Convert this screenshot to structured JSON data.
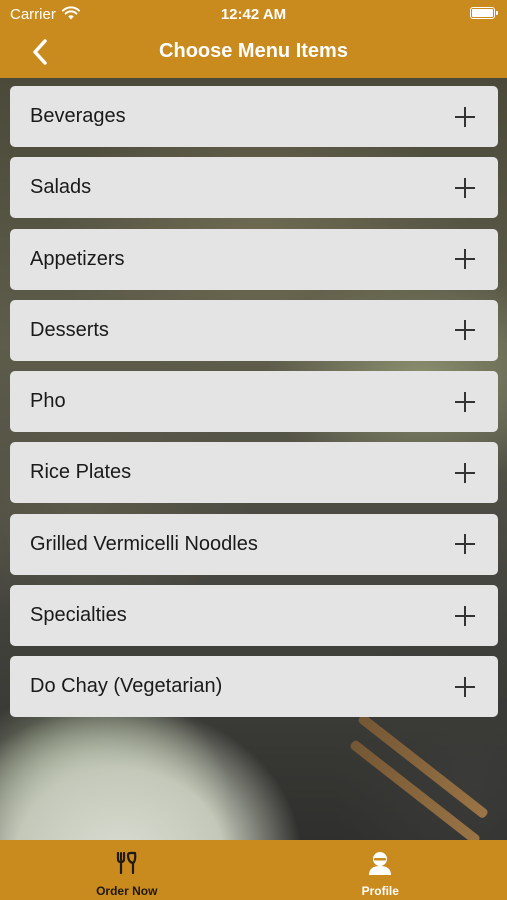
{
  "status_bar": {
    "carrier": "Carrier",
    "time": "12:42 AM"
  },
  "nav": {
    "title": "Choose Menu Items",
    "back_icon": "chevron-left-icon"
  },
  "menu": {
    "items": [
      {
        "label": "Beverages"
      },
      {
        "label": "Salads"
      },
      {
        "label": "Appetizers"
      },
      {
        "label": "Desserts"
      },
      {
        "label": "Pho"
      },
      {
        "label": "Rice Plates"
      },
      {
        "label": "Grilled Vermicelli Noodles"
      },
      {
        "label": "Specialties"
      },
      {
        "label": "Do Chay (Vegetarian)"
      }
    ],
    "expand_icon": "plus-icon"
  },
  "tab_bar": {
    "tabs": [
      {
        "label": "Order Now",
        "icon": "utensils-icon",
        "selected": false
      },
      {
        "label": "Profile",
        "icon": "profile-icon",
        "selected": true
      }
    ]
  },
  "colors": {
    "accent": "#c98a1e",
    "row_background": "#e4e4e4",
    "tab_selected": "#ffffff",
    "tab_unselected": "#1f1a10"
  }
}
